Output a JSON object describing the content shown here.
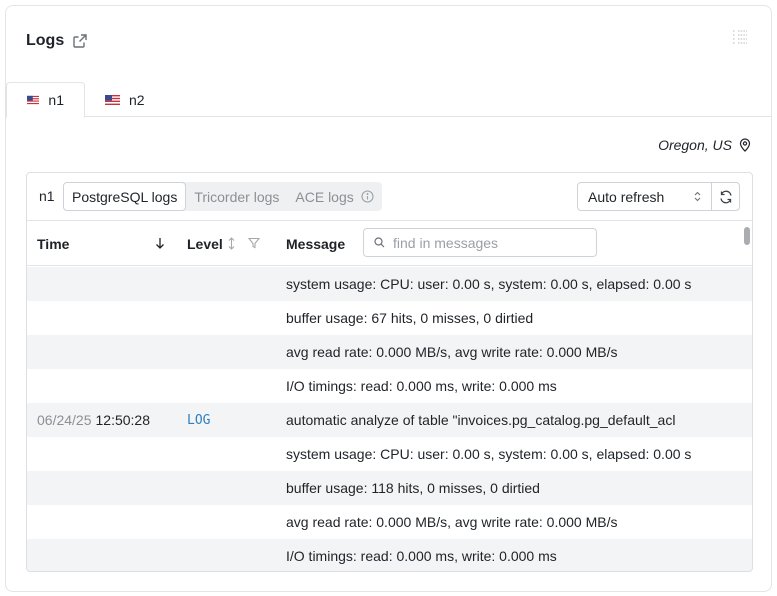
{
  "card": {
    "title": "Logs"
  },
  "tabs": [
    {
      "label": "n1",
      "flag": "us-flag",
      "active": true
    },
    {
      "label": "n2",
      "flag": "us-flag",
      "active": false
    }
  ],
  "region": "Oregon, US",
  "panel": {
    "node": "n1",
    "log_tabs": [
      {
        "label": "PostgreSQL logs",
        "active": true
      },
      {
        "label": "Tricorder logs",
        "active": false
      },
      {
        "label": "ACE logs",
        "active": false
      }
    ],
    "auto_refresh": "Auto refresh"
  },
  "table": {
    "headers": {
      "time": "Time",
      "level": "Level",
      "message": "Message"
    },
    "search_placeholder": "find in messages",
    "rows": [
      {
        "date": "",
        "time": "",
        "level": "",
        "message": "system usage: CPU: user: 0.00 s, system: 0.00 s, elapsed: 0.00 s"
      },
      {
        "date": "",
        "time": "",
        "level": "",
        "message": "buffer usage: 67 hits, 0 misses, 0 dirtied"
      },
      {
        "date": "",
        "time": "",
        "level": "",
        "message": "avg read rate: 0.000 MB/s, avg write rate: 0.000 MB/s"
      },
      {
        "date": "",
        "time": "",
        "level": "",
        "message": "I/O timings: read: 0.000 ms, write: 0.000 ms"
      },
      {
        "date": "06/24/25",
        "time": "12:50:28",
        "level": "LOG",
        "message": "automatic analyze of table \"invoices.pg_catalog.pg_default_acl"
      },
      {
        "date": "",
        "time": "",
        "level": "",
        "message": "system usage: CPU: user: 0.00 s, system: 0.00 s, elapsed: 0.00 s"
      },
      {
        "date": "",
        "time": "",
        "level": "",
        "message": "buffer usage: 118 hits, 0 misses, 0 dirtied"
      },
      {
        "date": "",
        "time": "",
        "level": "",
        "message": "avg read rate: 0.000 MB/s, avg write rate: 0.000 MB/s"
      },
      {
        "date": "",
        "time": "",
        "level": "",
        "message": "I/O timings: read: 0.000 ms, write: 0.000 ms"
      }
    ]
  },
  "colors": {
    "level_log": "#2f7fc1",
    "row_alt": "#f3f4f5"
  }
}
